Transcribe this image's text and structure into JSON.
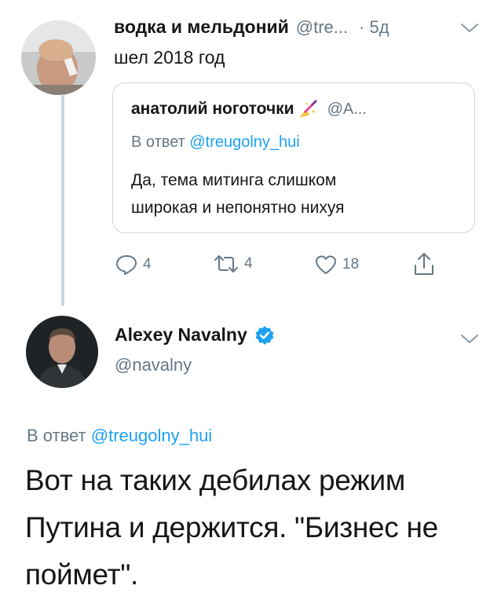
{
  "tweet1": {
    "author_name": "водка и мельдоний",
    "author_handle": "@tre...",
    "dot": "·",
    "time": "5д",
    "text": "шел 2018 год",
    "quote": {
      "author_name": "анатолий ноготочки",
      "author_handle": "@A...",
      "reply_to_prefix": "В ответ",
      "reply_to_handle": "@treugolny_hui",
      "text_line1": "Да, тема митинга слишком",
      "text_line2": "широкая и непонятно нихуя"
    },
    "actions": {
      "replies": "4",
      "retweets": "4",
      "likes": "18"
    }
  },
  "tweet2": {
    "author_name": "Alexey Navalny",
    "author_handle": "@navalny",
    "reply_to_prefix": "В ответ",
    "reply_to_handle": "@treugolny_hui",
    "text_line1": "Вот на таких дебилах режим",
    "text_line2": "Путина и держится. \"Бизнес не",
    "text_line3": "поймет\"."
  },
  "icons": {
    "reply": "reply-icon",
    "retweet": "retweet-icon",
    "like": "heart-icon",
    "share": "share-icon",
    "verified": "verified-badge-icon",
    "more": "chevron-down-icon",
    "nail_emoji": "nail-polish-emoji"
  },
  "colors": {
    "text": "#14171a",
    "muted": "#657786",
    "link": "#1da1f2",
    "border": "#ccd6dd",
    "thread_line": "#cfd6dc"
  }
}
